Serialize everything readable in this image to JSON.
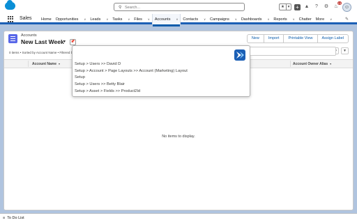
{
  "header": {
    "search_placeholder": "Search...",
    "notification_count": "13"
  },
  "nav": {
    "app_name": "Sales",
    "items": [
      {
        "label": "Home",
        "has_menu": false
      },
      {
        "label": "Opportunities",
        "has_menu": true
      },
      {
        "label": "Leads",
        "has_menu": true
      },
      {
        "label": "Tasks",
        "has_menu": true
      },
      {
        "label": "Files",
        "has_menu": true
      },
      {
        "label": "Accounts",
        "has_menu": true,
        "active": true
      },
      {
        "label": "Contacts",
        "has_menu": true
      },
      {
        "label": "Campaigns",
        "has_menu": true
      },
      {
        "label": "Dashboards",
        "has_menu": true
      },
      {
        "label": "Reports",
        "has_menu": true
      },
      {
        "label": "Chatter",
        "has_menu": false
      },
      {
        "label": "More",
        "has_menu": true
      }
    ]
  },
  "list_view": {
    "object_label": "Accounts",
    "view_name": "New Last Week",
    "subtitle": "0 items • Sorted by Account Name • Filtered by ...",
    "actions": [
      "New",
      "Import",
      "Printable View",
      "Assign Label"
    ],
    "columns": [
      {
        "label": "Account Name"
      },
      {
        "label": "Account Owner Alias"
      }
    ],
    "empty_message": "No items to display."
  },
  "popup": {
    "items": [
      "Setup > Users >> David D",
      "Setup > Account > Page Layouts >> Account (Marketing) Layout",
      "Setup",
      "Setup > Users >> Betty Blair",
      "Setup > Asset > Fields >> Product2Id"
    ]
  },
  "utility_bar": {
    "item_label": "To Do List"
  },
  "colors": {
    "brand_blue": "#0b5cab",
    "background": "#b0c4df",
    "object_icon": "#5867e8"
  }
}
